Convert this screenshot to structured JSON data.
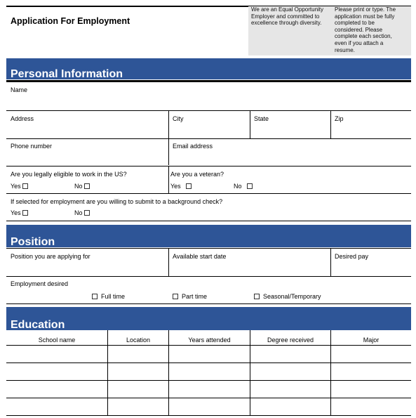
{
  "header": {
    "title": "Application For Employment",
    "eeo_notice": "We are an Equal Opportunity Employer and committed to excellence through diversity.",
    "instructions": "Please print or type. The application must be fully completed to be considered. Please complete each section, even if you attach a resume."
  },
  "colors": {
    "section_bar": "#2E5597",
    "notice_bg": "#E6E6E6"
  },
  "personal": {
    "heading": "Personal Information",
    "name_label": "Name",
    "address_label": "Address",
    "city_label": "City",
    "state_label": "State",
    "zip_label": "Zip",
    "phone_label": "Phone number",
    "email_label": "Email address",
    "eligible_question": "Are you legally eligible to work in the US?",
    "veteran_question": "Are you a veteran?",
    "background_question": "If selected for employment are you willing to submit to a background check?",
    "yes_label": "Yes",
    "no_label": "No"
  },
  "position": {
    "heading": "Position",
    "applying_for_label": "Position you are applying for",
    "start_date_label": "Available start date",
    "desired_pay_label": "Desired pay",
    "employment_desired_label": "Employment desired",
    "options": [
      "Full time",
      "Part time",
      "Seasonal/Temporary"
    ]
  },
  "education": {
    "heading": "Education",
    "columns": [
      "School name",
      "Location",
      "Years attended",
      "Degree received",
      "Major"
    ],
    "rows": [
      [
        "",
        "",
        "",
        "",
        ""
      ],
      [
        "",
        "",
        "",
        "",
        ""
      ],
      [
        "",
        "",
        "",
        "",
        ""
      ],
      [
        "",
        "",
        "",
        "",
        ""
      ]
    ]
  }
}
